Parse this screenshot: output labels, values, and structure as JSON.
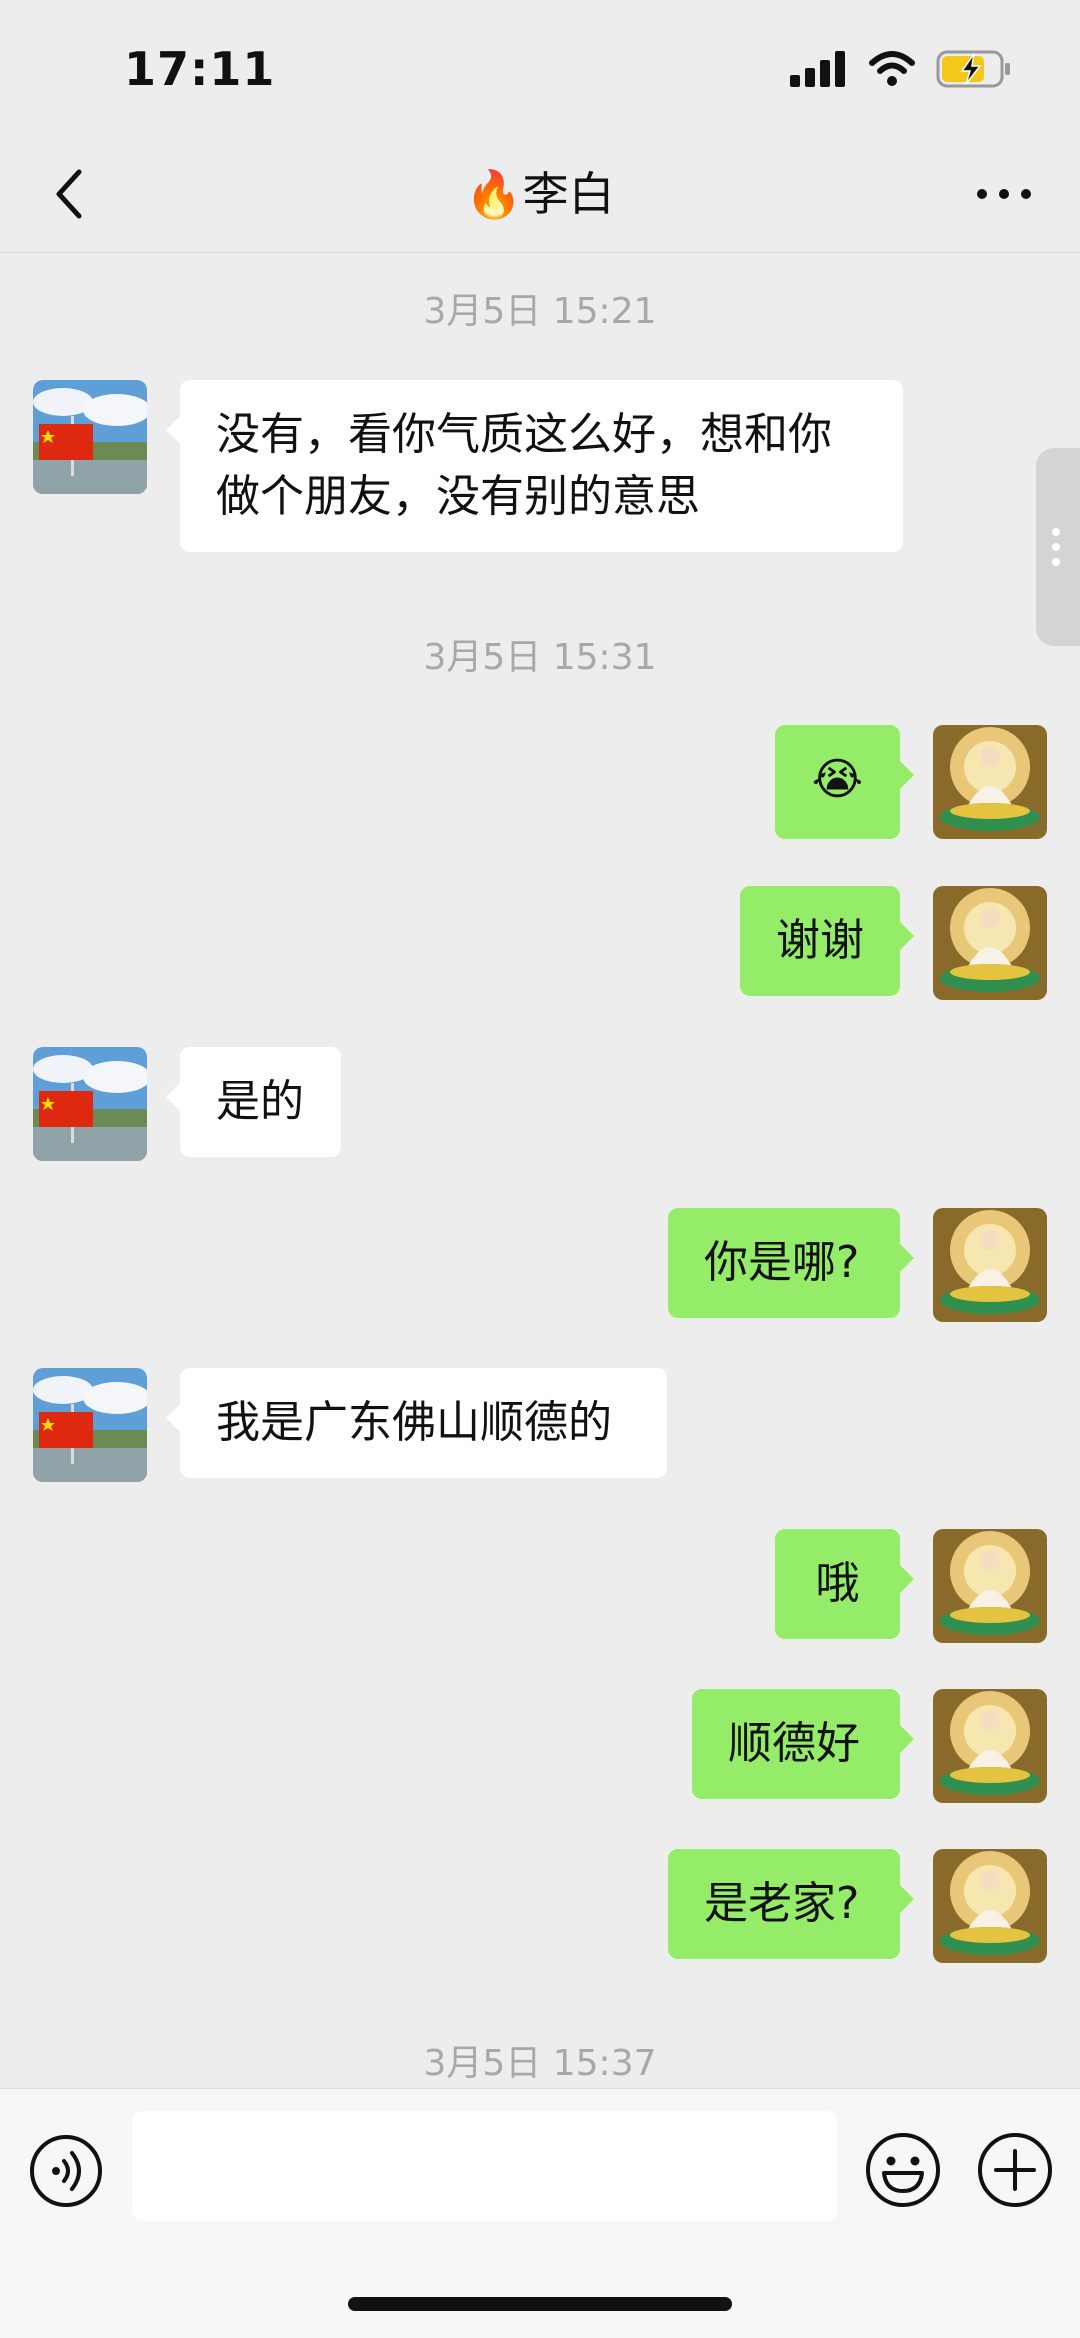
{
  "status_bar": {
    "time": "17:11",
    "battery_charging": true
  },
  "header": {
    "title_emoji": "🔥",
    "title": "李白"
  },
  "icons": {
    "back": "chevron-left-icon",
    "more": "more-horizontal-icon",
    "voice": "voice-icon",
    "emoji": "smiley-icon",
    "plus": "plus-icon"
  },
  "colors": {
    "background": "#ededed",
    "outgoing_bubble": "#95ec69",
    "incoming_bubble": "#ffffff",
    "timestamp": "#a8a8a8"
  },
  "messages": {
    "t1": "3月5日 15:21",
    "m1": "没有，看你气质这么好，想和你做个朋友，没有别的意思",
    "t2": "3月5日 15:31",
    "m2": "😭",
    "m3": "谢谢",
    "m4": "是的",
    "m5": "你是哪?",
    "m6": "我是广东佛山顺德的",
    "m7": "哦",
    "m8": "顺德好",
    "m9": "是老家?",
    "t3": "3月5日 15:37"
  },
  "composer": {
    "value": ""
  }
}
